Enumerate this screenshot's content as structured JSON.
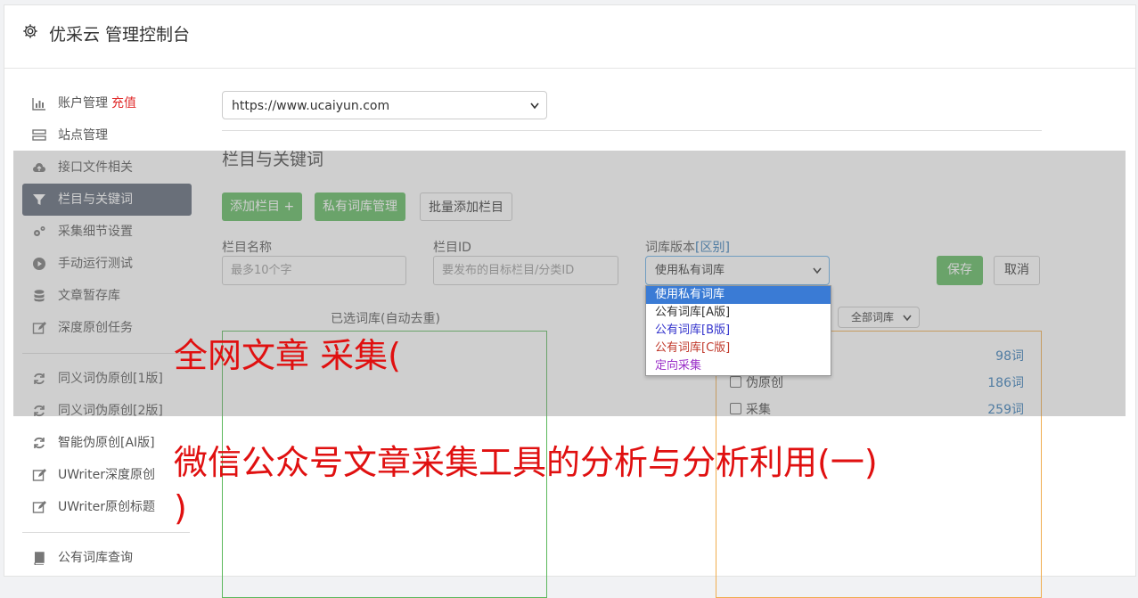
{
  "app": {
    "title": "优采云 管理控制台"
  },
  "sidebar": {
    "items": [
      {
        "label": "账户管理",
        "badge": "充值",
        "icon": "bar-chart-icon"
      },
      {
        "label": "站点管理",
        "icon": "server-icon"
      },
      {
        "label": "接口文件相关",
        "icon": "cloud-upload-icon"
      },
      {
        "label": "栏目与关键词",
        "icon": "filter-icon",
        "active": true
      },
      {
        "label": "采集细节设置",
        "icon": "gears-icon"
      },
      {
        "label": "手动运行测试",
        "icon": "play-circle-icon"
      },
      {
        "label": "文章暂存库",
        "icon": "database-icon"
      },
      {
        "label": "深度原创任务",
        "icon": "edit-icon"
      }
    ],
    "items2": [
      {
        "label": "同义词伪原创[1版]",
        "icon": "refresh-icon"
      },
      {
        "label": "同义词伪原创[2版]",
        "icon": "refresh-icon"
      },
      {
        "label": "智能伪原创[AI版]",
        "icon": "refresh-icon"
      },
      {
        "label": "UWriter深度原创",
        "icon": "edit-icon"
      },
      {
        "label": "UWriter原创标题",
        "icon": "edit-icon"
      }
    ],
    "items3": [
      {
        "label": "公有词库查询",
        "icon": "book-icon"
      }
    ]
  },
  "main": {
    "site_select": "https://www.ucaiyun.com",
    "section_title": "栏目与关键词",
    "buttons": {
      "add_column": "添加栏目 +",
      "private_lib": "私有词库管理",
      "batch_add": "批量添加栏目",
      "save": "保存",
      "cancel": "取消"
    },
    "fields": {
      "column_name_label": "栏目名称",
      "column_name_placeholder": "最多10个字",
      "column_id_label": "栏目ID",
      "column_id_placeholder": "要发布的目标栏目/分类ID",
      "lib_version_label": "词库版本",
      "lib_version_link": "[区别]",
      "lib_version_value": "使用私有词库"
    },
    "dropdown_options": [
      {
        "label": "使用私有词库",
        "color": "#ffffff"
      },
      {
        "label": "公有词库[A版]",
        "color": "#333333"
      },
      {
        "label": "公有词库[B版]",
        "color": "#3333cc"
      },
      {
        "label": "公有词库[C版]",
        "color": "#c0392b"
      },
      {
        "label": "定向采集",
        "color": "#9b30c8"
      }
    ],
    "selected_lib_title": "已选词库(自动去重)",
    "filter_select": "全部词库",
    "lib_rows": [
      {
        "label": "",
        "count": "98词"
      },
      {
        "label": "伪原创",
        "count": "186词"
      },
      {
        "label": "采集",
        "count": "259词"
      }
    ]
  },
  "overlay_text": {
    "line1": "全网文章 采集(",
    "line2": "微信公众号文章采集工具的分析与分析利用(一)",
    "line3": ")"
  },
  "colors": {
    "accent_green": "#5cb85c",
    "active_nav": "#5b6574",
    "overlay_red": "#e01010"
  }
}
